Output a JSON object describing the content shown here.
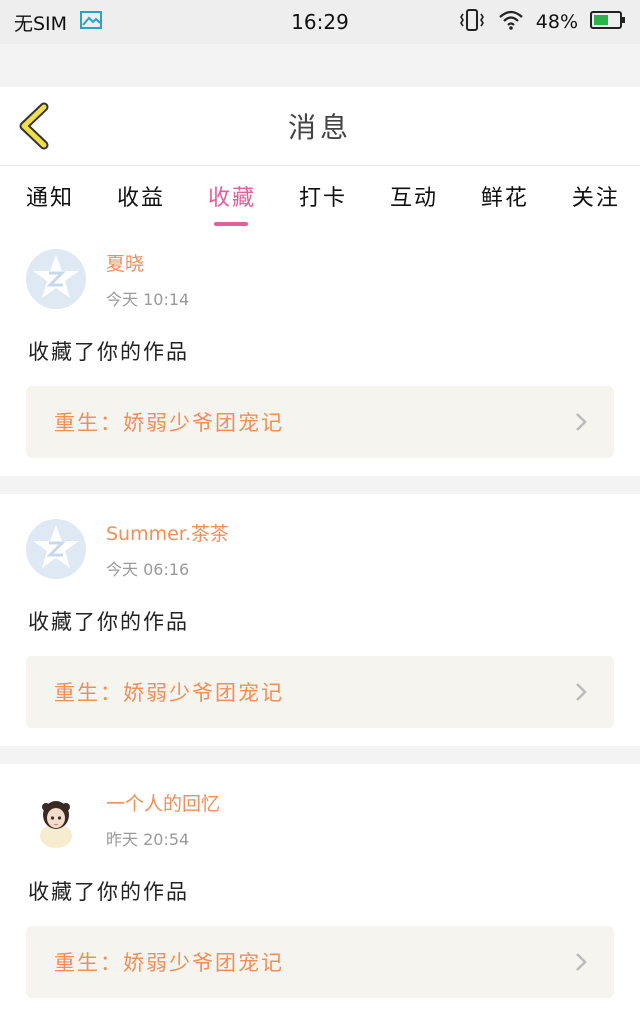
{
  "status_bar": {
    "sim_text": "无SIM",
    "time": "16:29",
    "battery_percent": "48%",
    "icons": [
      "image-icon",
      "vibrate-icon",
      "wifi-icon",
      "battery-icon"
    ]
  },
  "header": {
    "title": "消息",
    "back_icon": "chevron-left-icon"
  },
  "tabs": [
    {
      "label": "通知",
      "active": false
    },
    {
      "label": "收益",
      "active": false
    },
    {
      "label": "收藏",
      "active": true
    },
    {
      "label": "打卡",
      "active": false
    },
    {
      "label": "互动",
      "active": false
    },
    {
      "label": "鲜花",
      "active": false
    },
    {
      "label": "关注",
      "active": false
    }
  ],
  "messages": [
    {
      "user": "夏晓",
      "time": "今天 10:14",
      "action": "收藏了你的作品",
      "work_title": "重生：娇弱少爷团宠记",
      "avatar": "default-avatar-icon"
    },
    {
      "user": "Summer.茶茶",
      "time": "今天 06:16",
      "action": "收藏了你的作品",
      "work_title": "重生：娇弱少爷团宠记",
      "avatar": "default-avatar-icon"
    },
    {
      "user": "一个人的回忆",
      "time": "昨天 20:54",
      "action": "收藏了你的作品",
      "work_title": "重生：娇弱少爷团宠记",
      "avatar": "girl-avatar-icon"
    }
  ],
  "colors": {
    "accent_pink": "#e0609a",
    "orange_text": "#ef8f5a",
    "work_bg": "#f5f4ee",
    "back_arrow": "#f0df47"
  }
}
